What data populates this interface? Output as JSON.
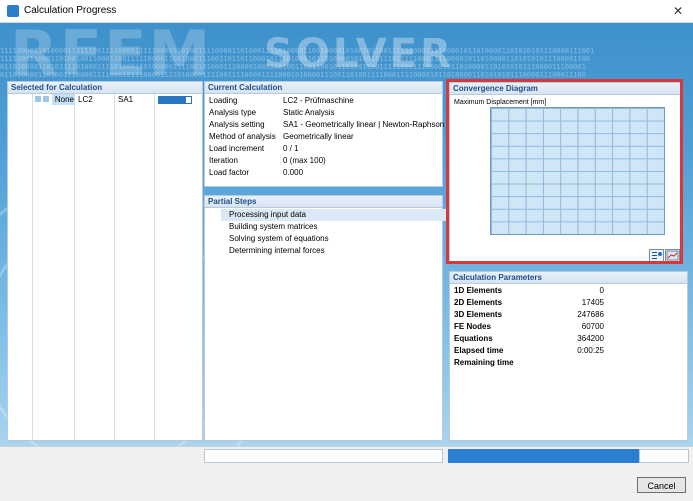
{
  "window": {
    "title": "Calculation Progress",
    "close_glyph": "✕"
  },
  "banner": {
    "logo_text": "RFEM",
    "solver_text": "SOLVER",
    "binary_lines": [
      "111100001101000011111100111100001111100001101001111000011010001111010000110010000101001011001111110001111000010110100001101010101110000111001",
      "11110001100011010010011000110011111000011001000111001101101100010111010001011010000101001011101111100011110000101101000011010101011100001100",
      "0110100001101011110100011110100011010000011110010100011100001000110100110011001011010011001111100011100001011010000110101010111000011100001",
      "0110100001101001110000111100010111000011110100001111001111000011110001010000111001101001111000111100001011010000110101010111000011100011100"
    ]
  },
  "selected": {
    "header": "Selected for Calculation",
    "row": {
      "name": "None",
      "lc": "LC2",
      "sa": "SA1",
      "progress": 0.85
    }
  },
  "current": {
    "header": "Current Calculation",
    "rows": [
      {
        "label": "Loading",
        "value": "LC2 - Prüfmaschine"
      },
      {
        "label": "Analysis type",
        "value": "Static Analysis"
      },
      {
        "label": "Analysis setting",
        "value": "SA1 - Geometrically linear | Newton-Raphson"
      },
      {
        "label": "Method of analysis",
        "value": "Geometrically linear"
      },
      {
        "label": "Load increment",
        "value": "0 / 1"
      },
      {
        "label": "Iteration",
        "value": "0 (max 100)"
      },
      {
        "label": "Load factor",
        "value": "0.000"
      }
    ]
  },
  "partial": {
    "header": "Partial Steps",
    "steps": [
      "Processing input data",
      "Building system matrices",
      "Solving system of equations",
      "Determining internal forces"
    ]
  },
  "convergence": {
    "header": "Convergence Diagram",
    "subtitle": "Maximum Displacement [mm]",
    "icons": [
      "info-list-icon",
      "chart-settings-icon"
    ]
  },
  "parameters": {
    "header": "Calculation Parameters",
    "rows": [
      {
        "label": "1D Elements",
        "value": "0"
      },
      {
        "label": "2D Elements",
        "value": "17405"
      },
      {
        "label": "3D Elements",
        "value": "247686"
      },
      {
        "label": "FE Nodes",
        "value": "60700"
      },
      {
        "label": "Equations",
        "value": "364200"
      },
      {
        "label": "Elapsed time",
        "value": "0:00:25"
      },
      {
        "label": "Remaining time",
        "value": ""
      }
    ]
  },
  "footer": {
    "cancel_label": "Cancel",
    "progress": 0.85
  },
  "colors": {
    "accent": "#2a7fd0",
    "highlight_outline": "#d9383a"
  }
}
